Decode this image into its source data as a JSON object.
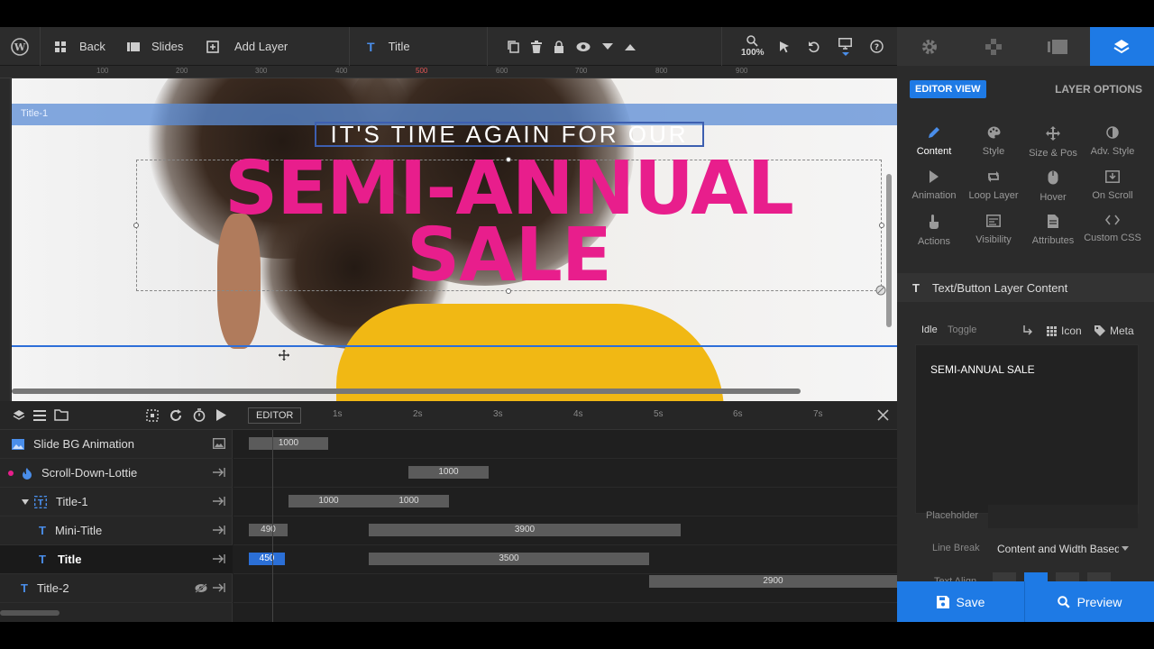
{
  "toolbar": {
    "back_label": "Back",
    "slides_label": "Slides",
    "add_layer_label": "Add Layer",
    "current_layer_label": "Title",
    "zoom": "100%"
  },
  "ruler": {
    "marks": [
      "100",
      "200",
      "300",
      "400",
      "500",
      "600",
      "700",
      "800",
      "900"
    ]
  },
  "canvas": {
    "container_label": "Title-1",
    "mini_title": "IT'S TIME AGAIN FOR OUR",
    "main_title_line1": "SEMI-ANNUAL",
    "main_title_line2": "SALE",
    "accent_color": "#e81e8c"
  },
  "timeline": {
    "editor_label": "EDITOR",
    "ticks": [
      "1s",
      "2s",
      "3s",
      "4s",
      "5s",
      "6s",
      "7s"
    ],
    "layers": [
      {
        "name": "Slide BG Animation",
        "bars": [
          {
            "label": "1000"
          }
        ]
      },
      {
        "name": "Scroll-Down-Lottie",
        "bars": [
          {
            "label": "1000"
          }
        ]
      },
      {
        "name": "Title-1",
        "bars": [
          {
            "label": "1000"
          },
          {
            "label": "1000"
          }
        ]
      },
      {
        "name": "Mini-Title",
        "bars": [
          {
            "label": "490"
          },
          {
            "label": "3900"
          }
        ]
      },
      {
        "name": "Title",
        "bars": [
          {
            "label": "450"
          },
          {
            "label": "3500"
          }
        ]
      },
      {
        "name": "Title-2",
        "bars": [
          {
            "label": "2900"
          }
        ]
      }
    ]
  },
  "panel": {
    "editor_view": "EDITOR VIEW",
    "layer_options": "LAYER OPTIONS",
    "options": [
      {
        "label": "Content",
        "icon": "pencil-icon"
      },
      {
        "label": "Style",
        "icon": "palette-icon"
      },
      {
        "label": "Size & Pos",
        "icon": "move-icon"
      },
      {
        "label": "Adv. Style",
        "icon": "contrast-icon"
      },
      {
        "label": "Animation",
        "icon": "play-icon"
      },
      {
        "label": "Loop Layer",
        "icon": "loop-icon"
      },
      {
        "label": "Hover",
        "icon": "mouse-icon"
      },
      {
        "label": "On Scroll",
        "icon": "scroll-icon"
      },
      {
        "label": "Actions",
        "icon": "hand-icon"
      },
      {
        "label": "Visibility",
        "icon": "visibility-icon"
      },
      {
        "label": "Attributes",
        "icon": "document-icon"
      },
      {
        "label": "Custom CSS",
        "icon": "code-icon"
      }
    ],
    "section_title": "Text/Button Layer Content",
    "idle": "Idle",
    "toggle": "Toggle",
    "icon_btn": "Icon",
    "meta_btn": "Meta",
    "editor_text": "SEMI-ANNUAL SALE",
    "placeholder_label": "Placeholder",
    "line_break_label": "Line Break",
    "line_break_value": "Content and Width Based",
    "text_align_label": "Text Align",
    "save": "Save",
    "preview": "Preview"
  }
}
